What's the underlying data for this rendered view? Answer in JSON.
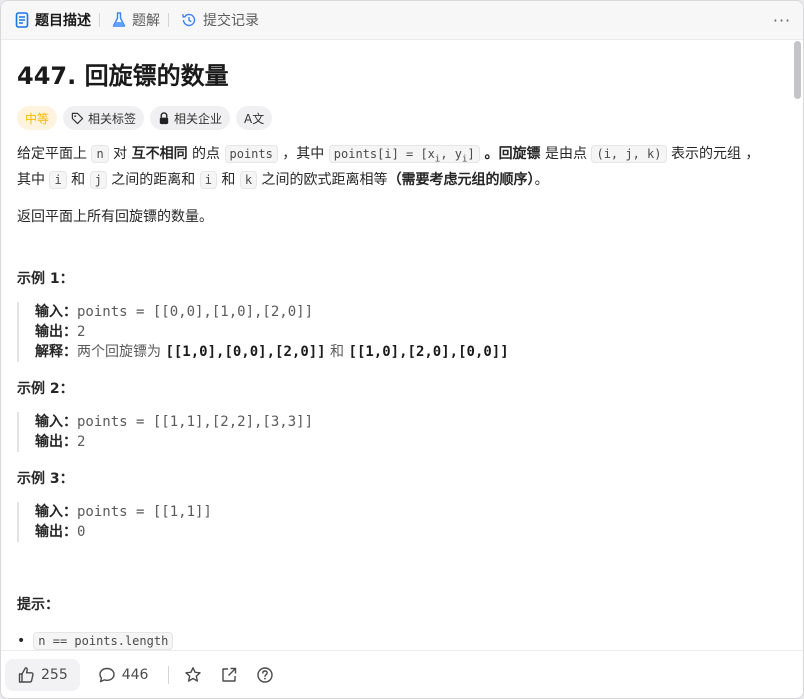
{
  "tabs": [
    {
      "label": "题目描述",
      "icon": "document-icon"
    },
    {
      "label": "题解",
      "icon": "flask-icon"
    },
    {
      "label": "提交记录",
      "icon": "history-icon"
    }
  ],
  "problem": {
    "title": "447. 回旋镖的数量",
    "tags": {
      "difficulty": "中等",
      "related_tags": "相关标签",
      "related_companies": "相关企业",
      "translate": "A文"
    },
    "desc": {
      "t1": "给定平面上 ",
      "c_n": "n",
      "t2": " 对 ",
      "b_distinct": "互不相同",
      "t3": " 的点 ",
      "c_points": "points",
      "t4": " ，其中 ",
      "c_pi": "points[i] = [x",
      "sub_i1": "i",
      "c_pi_mid": ", y",
      "sub_i2": "i",
      "c_pi_end": "]",
      "t5": " 。",
      "b_boomerang": "回旋镖",
      "t6": " 是由点 ",
      "c_tuple": "(i, j, k)",
      "t7": " 表示的元组 ，其中 ",
      "c_i": "i",
      "t8": " 和 ",
      "c_j": "j",
      "t9": " 之间的距离和 ",
      "c_i2": "i",
      "t10": " 和 ",
      "c_k": "k",
      "t11": " 之间的欧式距离相等",
      "b_order": "（需要考虑元组的顺序）",
      "t12": "。"
    },
    "return_text": "返回平面上所有回旋镖的数量。",
    "examples": [
      {
        "title": "示例 1：",
        "input_label": "输入：",
        "input": "points = [[0,0],[1,0],[2,0]]",
        "output_label": "输出：",
        "output": "2",
        "explain_label": "解释：",
        "explain_text": "两个回旋镖为 ",
        "explain_b1": "[[1,0],[0,0],[2,0]]",
        "explain_and": " 和 ",
        "explain_b2": "[[1,0],[2,0],[0,0]]"
      },
      {
        "title": "示例 2：",
        "input_label": "输入：",
        "input": "points = [[1,1],[2,2],[3,3]]",
        "output_label": "输出：",
        "output": "2"
      },
      {
        "title": "示例 3：",
        "input_label": "输入：",
        "input": "points = [[1,1]]",
        "output_label": "输出：",
        "output": "0"
      }
    ],
    "hints_title": "提示：",
    "hint_partial": "n == points.length"
  },
  "bottom": {
    "likes": "255",
    "comments": "446"
  },
  "colors": {
    "medium": "#ffb700",
    "accent": "#1a73e8"
  }
}
